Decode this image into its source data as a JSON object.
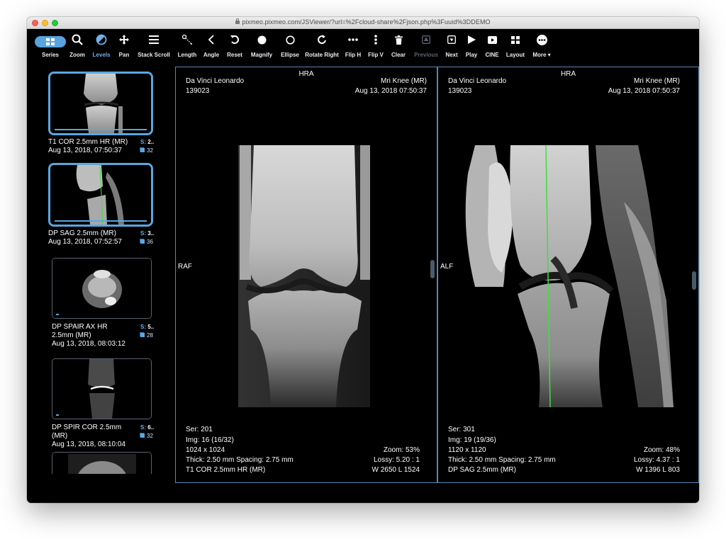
{
  "browser": {
    "url": "pixmeo.pixmeo.com/JSViewer/?url=%2Fcloud-share%2Fjson.php%3Fuuid%3DDEMO"
  },
  "toolbar": {
    "tools": [
      {
        "label": "Series",
        "icon": "grid-icon",
        "state": "active-pill"
      },
      {
        "label": "Zoom",
        "icon": "magnifier-icon",
        "state": "normal"
      },
      {
        "label": "Levels",
        "icon": "contrast-icon",
        "state": "active"
      },
      {
        "label": "Pan",
        "icon": "move-arrows-icon",
        "state": "normal"
      },
      {
        "label": "Stack Scroll",
        "icon": "bars-icon",
        "state": "normal"
      },
      {
        "label": "Length",
        "icon": "ruler-icon",
        "state": "normal"
      },
      {
        "label": "Angle",
        "icon": "angle-icon",
        "state": "normal"
      },
      {
        "label": "Reset",
        "icon": "reset-icon",
        "state": "normal"
      },
      {
        "label": "Magnify",
        "icon": "filled-circle-icon",
        "state": "normal"
      },
      {
        "label": "Ellipse",
        "icon": "circle-outline-icon",
        "state": "normal"
      },
      {
        "label": "Rotate Right",
        "icon": "rotate-right-icon",
        "state": "normal"
      },
      {
        "label": "Flip H",
        "icon": "dots-horizontal-icon",
        "state": "normal"
      },
      {
        "label": "Flip V",
        "icon": "dots-vertical-icon",
        "state": "normal"
      },
      {
        "label": "Clear",
        "icon": "trash-icon",
        "state": "normal"
      },
      {
        "label": "Previous",
        "icon": "previous-icon",
        "state": "disabled"
      },
      {
        "label": "Next",
        "icon": "next-icon",
        "state": "normal"
      },
      {
        "label": "Play",
        "icon": "play-icon",
        "state": "normal"
      },
      {
        "label": "CINE",
        "icon": "video-icon",
        "state": "normal"
      },
      {
        "label": "Layout",
        "icon": "layout-grid-icon",
        "state": "normal"
      },
      {
        "label": "More ▾",
        "icon": "more-icon",
        "state": "normal"
      }
    ]
  },
  "series_list": [
    {
      "name": "T1 COR 2.5mm HR (MR)",
      "date": "Aug 13, 2018, 07:50:37",
      "series_num": "2..",
      "image_count": "32",
      "selected": true
    },
    {
      "name": "DP SAG 2.5mm (MR)",
      "date": "Aug 13, 2018, 07:52:57",
      "series_num": "3..",
      "image_count": "36",
      "selected": true
    },
    {
      "name": "DP SPAIR AX HR 2.5mm (MR)",
      "date": "Aug 13, 2018, 08:03:12",
      "series_num": "5..",
      "image_count": "28",
      "selected": false
    },
    {
      "name": "DP SPIR COR 2.5mm (MR)",
      "date": "Aug 13, 2018, 08:10:04",
      "series_num": "6..",
      "image_count": "32",
      "selected": false
    },
    {
      "name": "",
      "date": "",
      "series_num": "",
      "image_count": "",
      "selected": false
    }
  ],
  "viewports": [
    {
      "top_center": "HRA",
      "patient_name": "Da Vinci Leonardo",
      "patient_id": "139023",
      "study": "Mri Knee (MR)",
      "study_date": "Aug 13, 2018 07:50:37",
      "left_marker": "RAF",
      "series": "Ser: 201",
      "image": "Img: 16 (16/32)",
      "dimensions": "1024 x 1024",
      "thickness": "Thick: 2.50 mm Spacing: 2.75 mm",
      "description": "T1 COR 2.5mm HR (MR)",
      "zoom": "Zoom: 53%",
      "lossy": "Lossy: 5.20 : 1",
      "window_level": "W 2650 L 1524"
    },
    {
      "top_center": "HRA",
      "patient_name": "Da Vinci Leonardo",
      "patient_id": "139023",
      "study": "Mri Knee (MR)",
      "study_date": "Aug 13, 2018 07:50:37",
      "left_marker": "ALF",
      "series": "Ser: 301",
      "image": "Img: 19 (19/36)",
      "dimensions": "1120 x 1120",
      "thickness": "Thick: 2.50 mm Spacing: 2.75 mm",
      "description": "DP SAG 2.5mm (MR)",
      "zoom": "Zoom: 48%",
      "lossy": "Lossy: 4.37 : 1",
      "window_level": "W 1396 L 803"
    }
  ],
  "colors": {
    "accent": "#58a4e0",
    "viewport_border": "#5487b6",
    "reference_line": "#3ee03a",
    "background": "#000000"
  }
}
